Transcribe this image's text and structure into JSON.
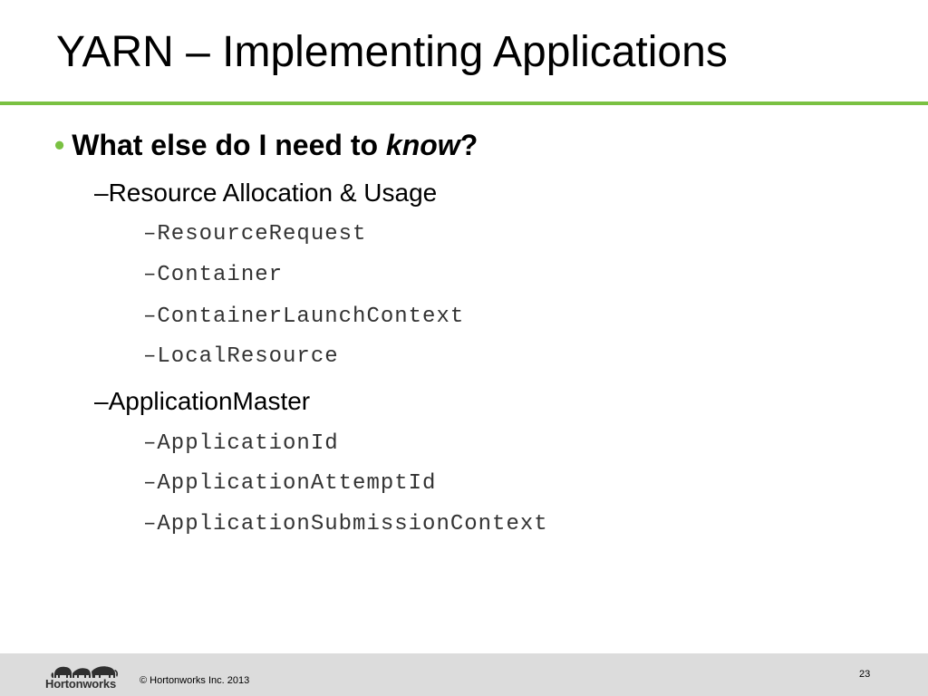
{
  "slide": {
    "title": "YARN – Implementing Applications"
  },
  "content": {
    "bullet_symbol": "•",
    "question": {
      "prefix": "What else do I need to ",
      "emphasis": "know",
      "suffix": "?"
    },
    "groups": [
      {
        "label": "–Resource Allocation & Usage",
        "items": [
          "–ResourceRequest",
          "–Container",
          "–ContainerLaunchContext",
          "–LocalResource"
        ]
      },
      {
        "label": "–ApplicationMaster",
        "items": [
          "–ApplicationId",
          "–ApplicationAttemptId",
          "–ApplicationSubmissionContext"
        ]
      }
    ]
  },
  "footer": {
    "logo_text": "Hortonworks",
    "copyright": "© Hortonworks Inc. 2013",
    "page_number": "23"
  },
  "colors": {
    "accent_green": "#7ac142",
    "footer_background": "#dcdcdc"
  }
}
